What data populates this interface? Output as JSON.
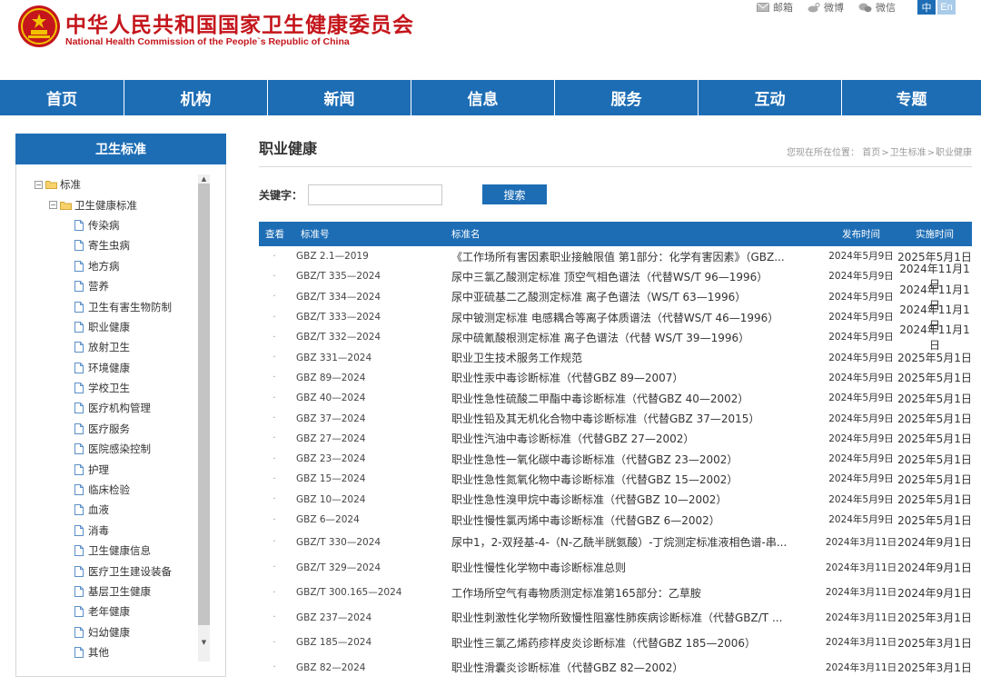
{
  "site": {
    "title": "中华人民共和国国家卫生健康委员会",
    "subtitle": "National Health Commission of the People`s Republic of China",
    "brand_color": "#c4161c",
    "accent_color": "#1d6db5"
  },
  "top_links": [
    {
      "label": "邮箱",
      "icon": "mail-icon"
    },
    {
      "label": "微博",
      "icon": "weibo-icon"
    },
    {
      "label": "微信",
      "icon": "wechat-icon"
    }
  ],
  "lang": {
    "zh": "中",
    "en": "En"
  },
  "nav": [
    {
      "label": "首页",
      "w": 137
    },
    {
      "label": "机构",
      "w": 158
    },
    {
      "label": "新闻",
      "w": 158
    },
    {
      "label": "信息",
      "w": 158
    },
    {
      "label": "服务",
      "w": 158
    },
    {
      "label": "互动",
      "w": 158
    },
    {
      "label": "专题",
      "w": 153
    }
  ],
  "sidebar": {
    "title": "卫生标准",
    "tree": [
      {
        "label": "标准",
        "level": 0,
        "type": "folder"
      },
      {
        "label": "卫生健康标准",
        "level": 1,
        "type": "folder"
      },
      {
        "label": "传染病",
        "level": 2,
        "type": "doc"
      },
      {
        "label": "寄生虫病",
        "level": 2,
        "type": "doc"
      },
      {
        "label": "地方病",
        "level": 2,
        "type": "doc"
      },
      {
        "label": "营养",
        "level": 2,
        "type": "doc"
      },
      {
        "label": "卫生有害生物防制",
        "level": 2,
        "type": "doc"
      },
      {
        "label": "职业健康",
        "level": 2,
        "type": "doc"
      },
      {
        "label": "放射卫生",
        "level": 2,
        "type": "doc"
      },
      {
        "label": "环境健康",
        "level": 2,
        "type": "doc"
      },
      {
        "label": "学校卫生",
        "level": 2,
        "type": "doc"
      },
      {
        "label": "医疗机构管理",
        "level": 2,
        "type": "doc"
      },
      {
        "label": "医疗服务",
        "level": 2,
        "type": "doc"
      },
      {
        "label": "医院感染控制",
        "level": 2,
        "type": "doc"
      },
      {
        "label": "护理",
        "level": 2,
        "type": "doc"
      },
      {
        "label": "临床检验",
        "level": 2,
        "type": "doc"
      },
      {
        "label": "血液",
        "level": 2,
        "type": "doc"
      },
      {
        "label": "消毒",
        "level": 2,
        "type": "doc"
      },
      {
        "label": "卫生健康信息",
        "level": 2,
        "type": "doc"
      },
      {
        "label": "医疗卫生建设装备",
        "level": 2,
        "type": "doc"
      },
      {
        "label": "基层卫生健康",
        "level": 2,
        "type": "doc"
      },
      {
        "label": "老年健康",
        "level": 2,
        "type": "doc"
      },
      {
        "label": "妇幼健康",
        "level": 2,
        "type": "doc"
      },
      {
        "label": "其他",
        "level": 2,
        "type": "doc"
      }
    ]
  },
  "main": {
    "title": "职业健康",
    "breadcrumb": {
      "prefix": "您现在所在位置：",
      "items": [
        "首页",
        "卫生标准",
        "职业健康"
      ]
    },
    "search": {
      "label": "关键字：",
      "value": "",
      "button": "搜索"
    },
    "table": {
      "headers": {
        "view": "查看",
        "code": "标准号",
        "name": "标准名",
        "pub": "发布时间",
        "eff": "实施时间"
      },
      "rows": [
        {
          "view": "·",
          "code": "GBZ 2.1—2019",
          "name": "《工作场所有害因素职业接触限值 第1部分：化学有害因素》（GBZ...",
          "pub": "2024年5月9日",
          "eff": "2025年5月1日"
        },
        {
          "view": "·",
          "code": "GBZ/T 335—2024",
          "name": "尿中三氯乙酸测定标准 顶空气相色谱法（代替WS/T 96—1996）",
          "pub": "2024年5月9日",
          "eff": "2024年11月1日"
        },
        {
          "view": "·",
          "code": "GBZ/T 334—2024",
          "name": "尿中亚硫基二乙酸测定标准 离子色谱法（WS/T 63—1996）",
          "pub": "2024年5月9日",
          "eff": "2024年11月1日"
        },
        {
          "view": "·",
          "code": "GBZ/T 333—2024",
          "name": "尿中铍测定标准 电感耦合等离子体质谱法（代替WS/T 46—1996）",
          "pub": "2024年5月9日",
          "eff": "2024年11月1日"
        },
        {
          "view": "·",
          "code": "GBZ/T 332—2024",
          "name": "尿中硫氰酸根测定标准 离子色谱法（代替 WS/T 39—1996）",
          "pub": "2024年5月9日",
          "eff": "2024年11月1日"
        },
        {
          "view": "·",
          "code": "GBZ 331—2024",
          "name": "职业卫生技术服务工作规范",
          "pub": "2024年5月9日",
          "eff": "2025年5月1日"
        },
        {
          "view": "·",
          "code": "GBZ 89—2024",
          "name": "职业性汞中毒诊断标准（代替GBZ 89—2007）",
          "pub": "2024年5月9日",
          "eff": "2025年5月1日"
        },
        {
          "view": "·",
          "code": "GBZ 40—2024",
          "name": "职业性急性硫酸二甲酯中毒诊断标准（代替GBZ 40—2002）",
          "pub": "2024年5月9日",
          "eff": "2025年5月1日"
        },
        {
          "view": "·",
          "code": "GBZ 37—2024",
          "name": "职业性铅及其无机化合物中毒诊断标准（代替GBZ 37—2015）",
          "pub": "2024年5月9日",
          "eff": "2025年5月1日"
        },
        {
          "view": "·",
          "code": "GBZ 27—2024",
          "name": "职业性汽油中毒诊断标准（代替GBZ 27—2002）",
          "pub": "2024年5月9日",
          "eff": "2025年5月1日"
        },
        {
          "view": "·",
          "code": "GBZ 23—2024",
          "name": "职业性急性一氧化碳中毒诊断标准（代替GBZ 23—2002）",
          "pub": "2024年5月9日",
          "eff": "2025年5月1日"
        },
        {
          "view": "·",
          "code": "GBZ 15—2024",
          "name": "职业性急性氮氧化物中毒诊断标准（代替GBZ 15—2002）",
          "pub": "2024年5月9日",
          "eff": "2025年5月1日"
        },
        {
          "view": "·",
          "code": "GBZ 10—2024",
          "name": "职业性急性溴甲烷中毒诊断标准（代替GBZ 10—2002）",
          "pub": "2024年5月9日",
          "eff": "2025年5月1日"
        },
        {
          "view": "·",
          "code": "GBZ 6—2024",
          "name": "职业性慢性氯丙烯中毒诊断标准（代替GBZ 6—2002）",
          "pub": "2024年5月9日",
          "eff": "2025年5月1日"
        },
        {
          "view": "·",
          "code": "GBZ/T 330—2024",
          "name": "尿中1，2-双羟基-4-（N-乙酰半胱氨酸）-丁烷测定标准液相色谱-串...",
          "pub": "2024年3月11日",
          "eff": "2024年9月1日",
          "tall": true
        },
        {
          "view": "·",
          "code": "GBZ/T 329—2024",
          "name": "职业性慢性化学物中毒诊断标准总则",
          "pub": "2024年3月11日",
          "eff": "2024年9月1日",
          "tall": true
        },
        {
          "view": "·",
          "code": "GBZ/T 300.165—2024",
          "name": "工作场所空气有毒物质测定标准第165部分：乙草胺",
          "pub": "2024年3月11日",
          "eff": "2024年9月1日",
          "tall": true
        },
        {
          "view": "·",
          "code": "GBZ 237—2024",
          "name": "职业性刺激性化学物所致慢性阻塞性肺疾病诊断标准（代替GBZ/T ...",
          "pub": "2024年3月11日",
          "eff": "2025年3月1日",
          "tall": true
        },
        {
          "view": "·",
          "code": "GBZ 185—2024",
          "name": "职业性三氯乙烯药疹样皮炎诊断标准（代替GBZ 185—2006）",
          "pub": "2024年3月11日",
          "eff": "2025年3月1日",
          "tall": true
        },
        {
          "view": "·",
          "code": "GBZ 82—2024",
          "name": "职业性滑囊炎诊断标准（代替GBZ 82—2002）",
          "pub": "2024年3月11日",
          "eff": "2025年3月1日",
          "tall": true
        }
      ]
    }
  }
}
